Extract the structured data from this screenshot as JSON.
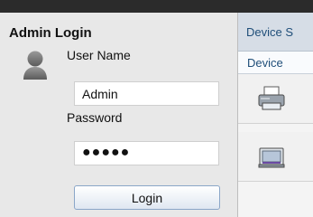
{
  "login": {
    "title": "Admin Login",
    "username_label": "User Name",
    "username_value": "Admin",
    "password_label": "Password",
    "password_value": "●●●●●",
    "login_button": "Login"
  },
  "right": {
    "header_text": "Device S",
    "tab_text": "Device",
    "icons": [
      "printer-icon",
      "scanner-icon"
    ]
  }
}
